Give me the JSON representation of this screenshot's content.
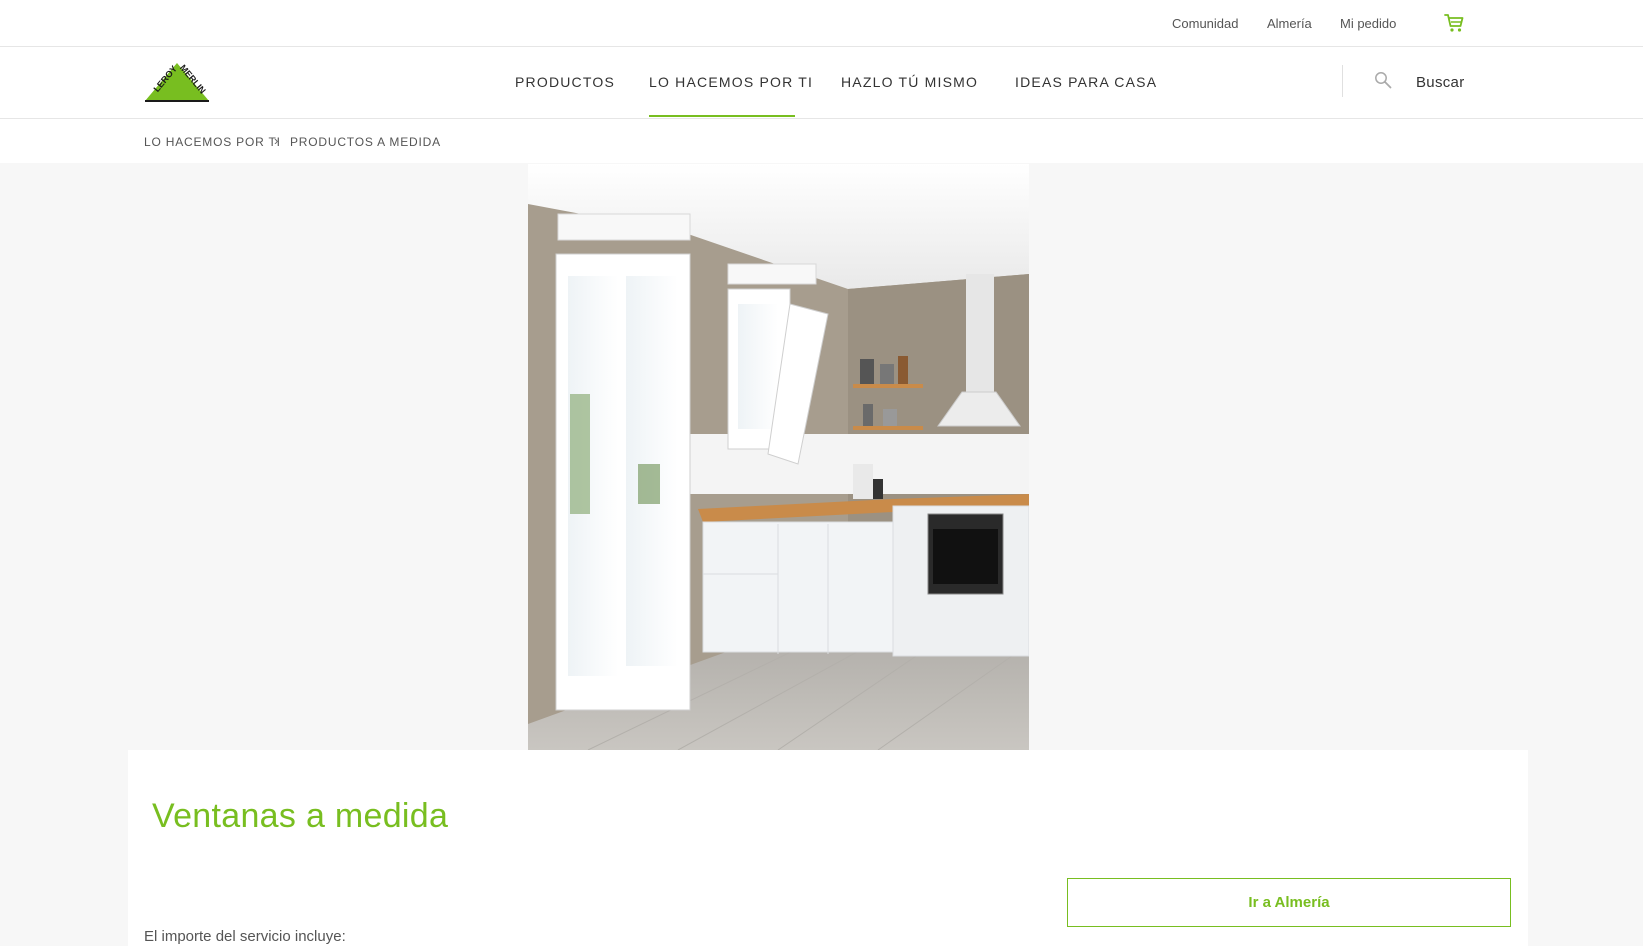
{
  "topbar": {
    "links": [
      "Comunidad",
      "Almería",
      "Mi pedido"
    ],
    "cart_icon": "cart-icon",
    "accent_color": "#78be20"
  },
  "header": {
    "logo_text": "LEROY MERLIN",
    "nav": [
      "PRODUCTOS",
      "LO HACEMOS POR TI",
      "HAZLO TÚ MISMO",
      "IDEAS PARA CASA"
    ],
    "active_nav": "LO HACEMOS POR TI",
    "search_icon": "search-icon",
    "search_label": "Buscar"
  },
  "breadcrumb": {
    "items": [
      "LO HACEMOS POR TI",
      "PRODUCTOS A MEDIDA"
    ],
    "separator": ">"
  },
  "main": {
    "hero_image": "kitchen-with-windows-illustration",
    "title": "Ventanas a medida",
    "store_button": "Ir a Almería",
    "intro_text": "El importe del servicio incluye:"
  }
}
